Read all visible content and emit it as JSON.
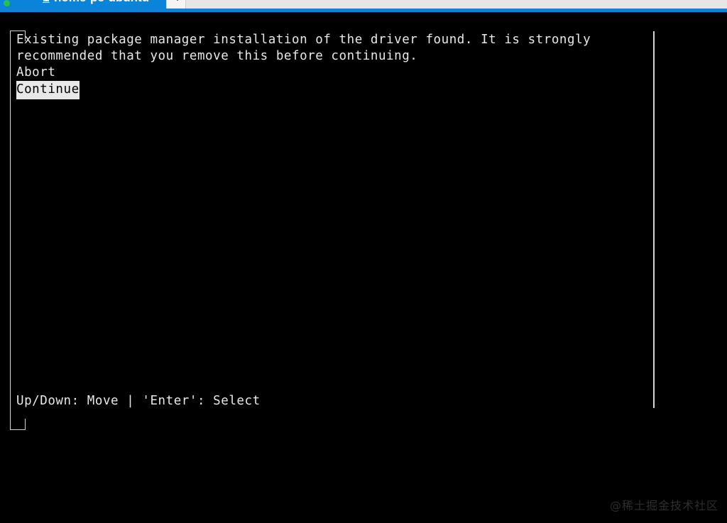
{
  "window": {
    "tabbar": {
      "active_tab": {
        "status_dot": "connection-active",
        "index": "1",
        "title": "home-pc-ubuntu",
        "close_label": "×"
      },
      "new_tab_label": "+",
      "accent_color": "#1183d6",
      "active_tab_color": "#0a84d8",
      "bar_color": "#e6e6e6"
    }
  },
  "terminal": {
    "background_color": "#000000",
    "foreground_color": "#e8e8e8",
    "dialog": {
      "message_lines": [
        "Existing package manager installation of the driver found. It is strongly",
        "recommended that you remove this before continuing."
      ],
      "options": [
        {
          "label": "Abort",
          "selected": false
        },
        {
          "label": "Continue",
          "selected": true
        }
      ],
      "status_hint": "Up/Down: Move | 'Enter': Select",
      "border_color": "#d5d5d5",
      "selection_background": "#e8e8e8",
      "selection_foreground": "#000000"
    }
  },
  "watermark": {
    "text": "@稀土掘金技术社区"
  }
}
